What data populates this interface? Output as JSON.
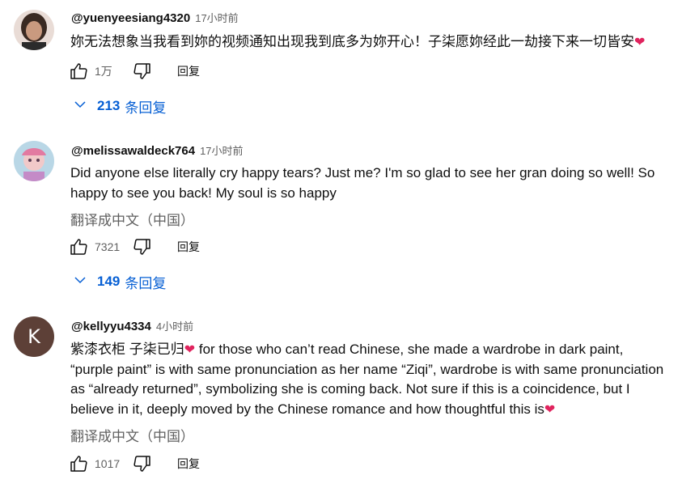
{
  "comments": [
    {
      "author": "@yuenyeesiang4320",
      "time": "17小时前",
      "text": "妳无法想象当我看到妳的视频通知出现我到底多为妳开心！子柒愿妳经此一劫接下来一切皆安",
      "like_count": "1万",
      "reply_label": "回复",
      "replies_count": "213",
      "replies_label": "条回复"
    },
    {
      "author": "@melissawaldeck764",
      "time": "17小时前",
      "text_line1": "Did anyone else literally cry happy tears? Just me? I'm so glad to see her gran doing so well! So",
      "text_line2": "happy to see you back! My soul is so happy",
      "translate": "翻译成中文（中国）",
      "like_count": "7321",
      "reply_label": "回复",
      "replies_count": "149",
      "replies_label": "条回复"
    },
    {
      "author": "@kellyyu4334",
      "time": "4小时前",
      "avatar_letter": "K",
      "text_cn": "紫漆衣柜 子柒已归",
      "text_line1": " for those who can’t read Chinese, she made a wardrobe in dark paint,",
      "text_line2": "“purple paint” is with same pronunciation as her name “Ziqi”, wardrobe is with same pronunciation",
      "text_line3": "as “already returned”, symbolizing she is coming back. Not sure if this is a coincidence, but I",
      "text_line4": "believe in it, deeply moved by the Chinese romance and how thoughtful this is",
      "translate": "翻译成中文（中国）",
      "like_count": "1017",
      "reply_label": "回复"
    }
  ],
  "icons": {
    "like": "thumbs-up-icon",
    "dislike": "thumbs-down-icon",
    "expand": "chevron-down-icon",
    "heart": "heart-emoji"
  },
  "colors": {
    "link": "#065fd4",
    "muted": "#606060",
    "heart": "#e0245e"
  }
}
